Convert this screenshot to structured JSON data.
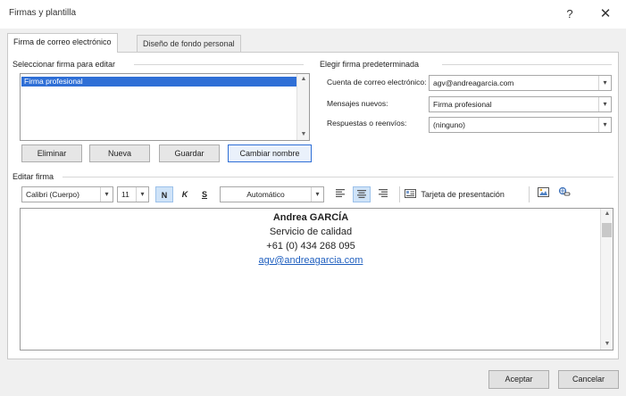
{
  "window": {
    "title": "Firmas y plantilla",
    "help_label": "?",
    "close_label": "✕"
  },
  "tabs": [
    {
      "label": "Firma de correo electrónico",
      "selected": true
    },
    {
      "label": "Diseño de fondo personal",
      "selected": false
    }
  ],
  "select_signature": {
    "label": "Seleccionar firma para editar",
    "items": [
      "Firma profesional"
    ],
    "buttons": {
      "delete": "Eliminar",
      "new": "Nueva",
      "save": "Guardar",
      "rename": "Cambiar nombre"
    }
  },
  "default_signature": {
    "label": "Elegir firma predeterminada",
    "account_label": "Cuenta de correo electrónico:",
    "account_value": "agv@andreagarcia.com",
    "new_messages_label": "Mensajes nuevos:",
    "new_messages_value": "Firma profesional",
    "replies_label": "Respuestas o reenvíos:",
    "replies_value": "(ninguno)"
  },
  "edit_signature": {
    "label": "Editar firma",
    "font_value": "Calibri (Cuerpo)",
    "size_value": "11",
    "bold_label": "N",
    "italic_label": "K",
    "underline_label": "S",
    "color_value": "Automático",
    "business_card_label": "Tarjeta de presentación"
  },
  "signature_content": {
    "name": "Andrea GARCÍA",
    "department": "Servicio de calidad",
    "phone": "+61 (0) 434 268 095",
    "email": "agv@andreagarcia.com"
  },
  "footer": {
    "ok_label": "Aceptar",
    "cancel_label": "Cancelar"
  },
  "icons": {
    "dropdown": "▾",
    "scroll_up": "▲",
    "scroll_down": "▼"
  },
  "colors": {
    "accent": "#2f6fd6",
    "link": "#1f5fbf"
  }
}
